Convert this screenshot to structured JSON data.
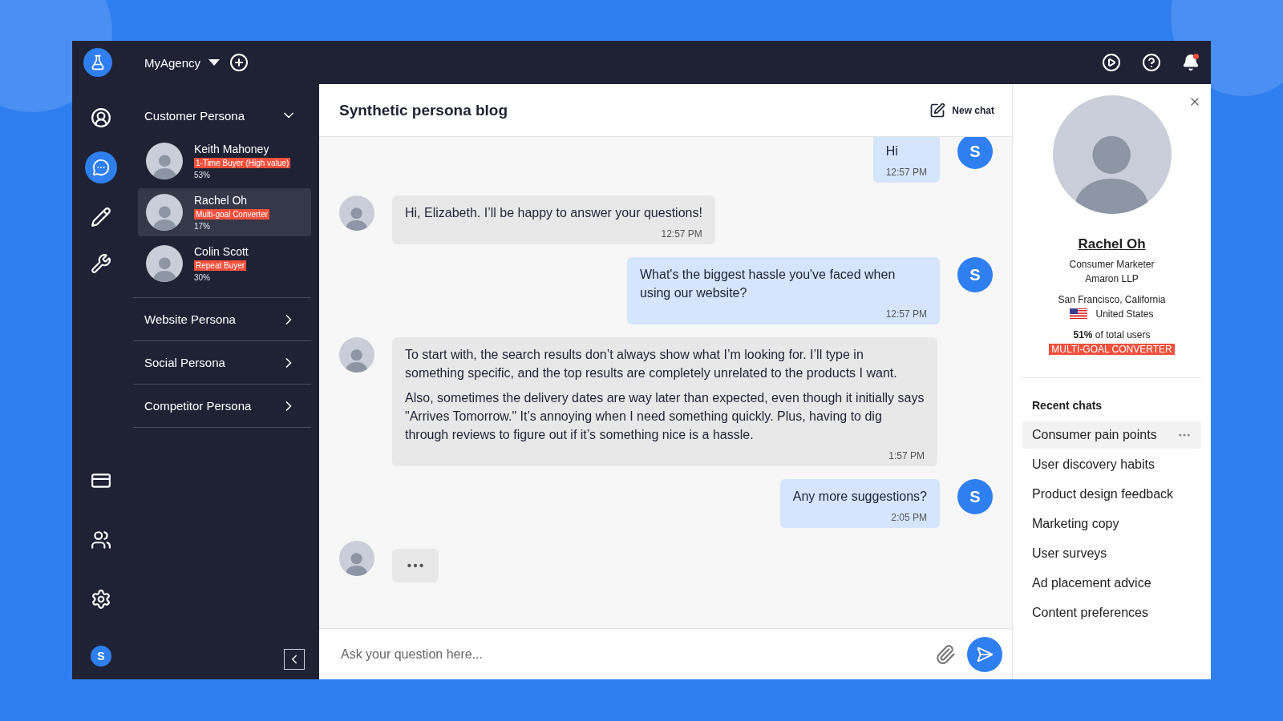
{
  "topbar": {
    "agency": "MyAgency"
  },
  "rail": {
    "items": [
      {
        "kind": "user",
        "selected": false
      },
      {
        "kind": "chat",
        "selected": true
      },
      {
        "kind": "pencil",
        "selected": false
      },
      {
        "kind": "tools",
        "selected": false
      }
    ],
    "bottom": [
      {
        "kind": "card"
      },
      {
        "kind": "team"
      },
      {
        "kind": "settings"
      }
    ],
    "user_initial": "S"
  },
  "persona_groups": [
    {
      "title": "Customer Persona",
      "expanded": true,
      "members": [
        {
          "name": "Keith Mahoney",
          "tag": "1-Time Buyer (High value)",
          "percent": "53%",
          "selected": false
        },
        {
          "name": "Rachel Oh",
          "tag": "Multi-goal Converter",
          "percent": "17%",
          "selected": true
        },
        {
          "name": "Colin Scott",
          "tag": "Repeat Buyer",
          "percent": "30%",
          "selected": false
        }
      ]
    },
    {
      "title": "Website Persona",
      "expanded": false
    },
    {
      "title": "Social Persona",
      "expanded": false
    },
    {
      "title": "Competitor Persona",
      "expanded": false
    }
  ],
  "chat": {
    "title": "Synthetic persona blog",
    "new_chat": "New chat",
    "messages": [
      {
        "kind": "user",
        "initial": "S",
        "paragraphs": [
          "Hi"
        ],
        "time": "12:57 PM"
      },
      {
        "kind": "persona",
        "paragraphs": [
          "Hi, Elizabeth. I’ll be happy to answer your questions!"
        ],
        "time": "12:57 PM"
      },
      {
        "kind": "user",
        "initial": "S",
        "paragraphs": [
          "What's the biggest hassle you've faced when using our website?"
        ],
        "time": "12:57 PM"
      },
      {
        "kind": "persona",
        "paragraphs": [
          "To start with, the search results don’t always show what I’m looking for. I’ll type in something specific, and the top results are completely unrelated to the products I want.",
          "Also, sometimes the delivery dates are way later than expected, even though it initially says \"Arrives Tomorrow.\" It’s annoying when I need something quickly. Plus, having to dig through reviews to figure out if it’s something nice is a hassle."
        ],
        "time": "1:57 PM"
      },
      {
        "kind": "user",
        "initial": "S",
        "paragraphs": [
          "Any more suggestions?"
        ],
        "time": "2:05 PM"
      }
    ],
    "typing": true,
    "input": {
      "placeholder": "Ask your question here..."
    }
  },
  "profile": {
    "name": "Rachel Oh",
    "role": "Consumer Marketer",
    "company": "Amaron LLP",
    "location": "San Francisco, California",
    "country": "United States",
    "share": "**51%** of total users",
    "tag": "MULTI-GOAL CONVERTER"
  },
  "recent_chats": {
    "title": "Recent chats",
    "items": [
      {
        "label": "Consumer pain points",
        "selected": true
      },
      {
        "label": "User discovery habits",
        "selected": false
      },
      {
        "label": "Product design feedback",
        "selected": false
      },
      {
        "label": "Marketing copy",
        "selected": false
      },
      {
        "label": "User surveys",
        "selected": false
      },
      {
        "label": "Ad placement advice",
        "selected": false
      },
      {
        "label": "Content preferences",
        "selected": false
      }
    ]
  }
}
